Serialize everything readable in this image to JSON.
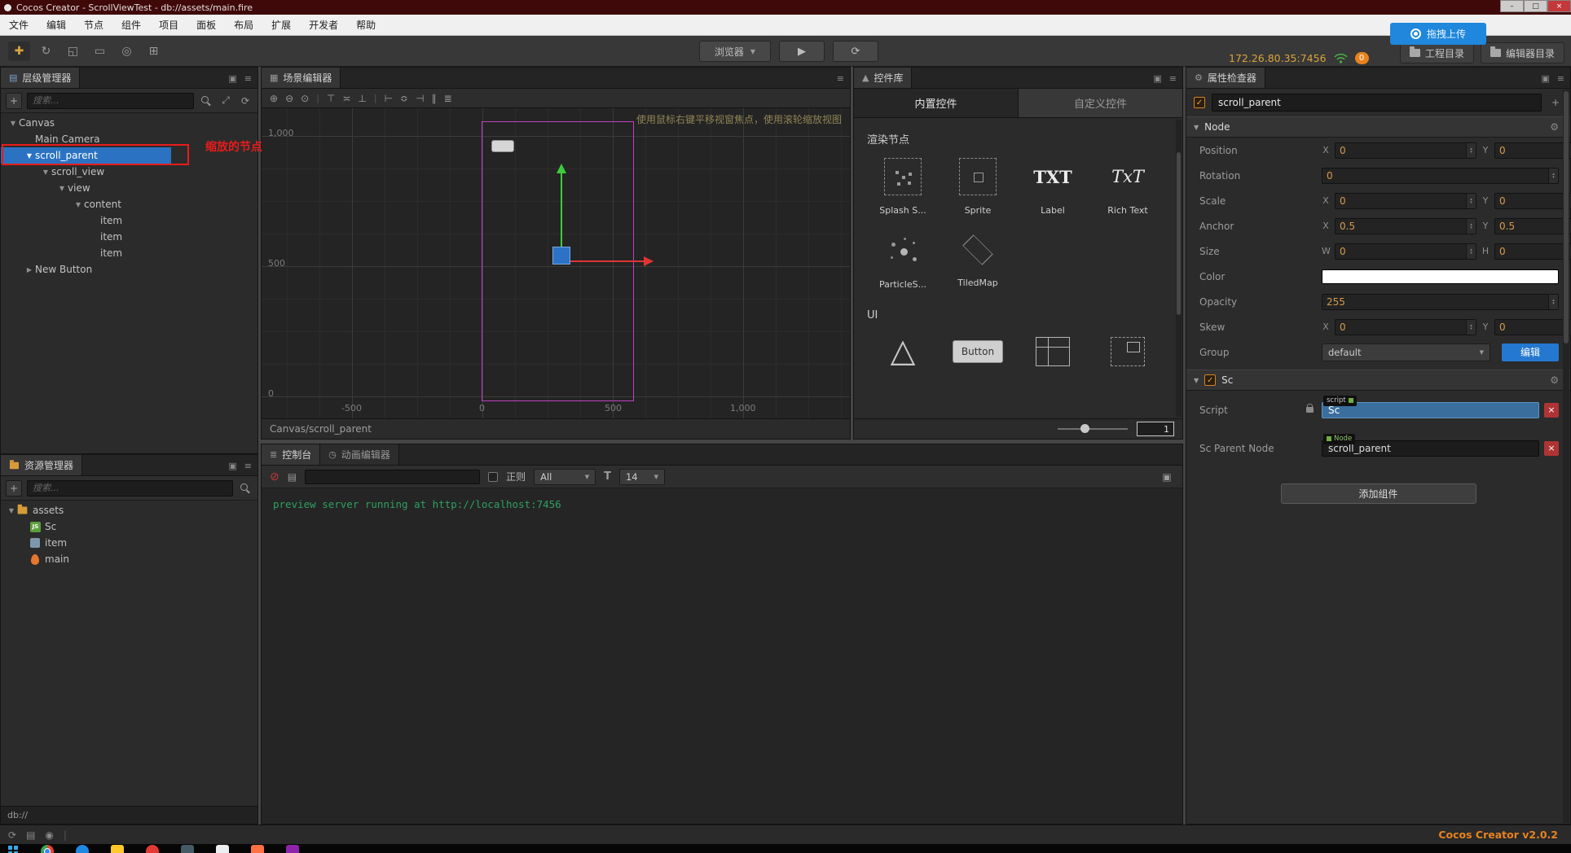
{
  "window": {
    "title": "Cocos Creator - ScrollViewTest - db://assets/main.fire"
  },
  "icons": {
    "minimize": "–",
    "maximize": "□",
    "close": "×",
    "hierarchy": "▤",
    "scene": "▦",
    "widgets": "▲",
    "inspector": "⚙",
    "console": "≣",
    "animation": "◷",
    "panel": "▣",
    "menu": "≡",
    "plus": "+",
    "caret": "▼",
    "play": "▶",
    "refresh": "⟳",
    "check": "✓",
    "expand": "⤢",
    "gear": "⚙",
    "clear": "⊘",
    "file": "▤",
    "font": "T",
    "popout": "▣",
    "eye": "◉",
    "list": "▤",
    "reload": "⟳"
  },
  "menubar": {
    "items": [
      "文件",
      "编辑",
      "节点",
      "组件",
      "项目",
      "面板",
      "布局",
      "扩展",
      "开发者",
      "帮助"
    ]
  },
  "toolbar": {
    "tools": [
      {
        "name": "move-tool-icon",
        "g": "✚"
      },
      {
        "name": "rotate-tool-icon",
        "g": "↻"
      },
      {
        "name": "scale-tool-icon",
        "g": "◱"
      },
      {
        "name": "rect-tool-icon",
        "g": "▭"
      },
      {
        "name": "pivot-tool-icon",
        "g": "◎"
      },
      {
        "name": "grid-tool-icon",
        "g": "⊞"
      }
    ],
    "browser_label": "浏览器",
    "address": "172.26.80.35:7456",
    "notification_count": "0",
    "upload_label": "拖拽上传",
    "project_dir_label": "工程目录",
    "editor_dir_label": "编辑器目录"
  },
  "hierarchy": {
    "tab": "层级管理器",
    "search_placeholder": "搜索...",
    "annotation": {
      "text": "缩放的节点",
      "color": "#e81c1c"
    },
    "nodes": [
      {
        "label": "Canvas",
        "depth": 0,
        "arrow": "▼",
        "selected": false
      },
      {
        "label": "Main Camera",
        "depth": 1,
        "arrow": "",
        "selected": false
      },
      {
        "label": "scroll_parent",
        "depth": 1,
        "arrow": "▼",
        "selected": true
      },
      {
        "label": "scroll_view",
        "depth": 2,
        "arrow": "▼",
        "selected": false
      },
      {
        "label": "view",
        "depth": 3,
        "arrow": "▼",
        "selected": false
      },
      {
        "label": "content",
        "depth": 4,
        "arrow": "▼",
        "selected": false
      },
      {
        "label": "item",
        "depth": 5,
        "arrow": "",
        "selected": false
      },
      {
        "label": "item",
        "depth": 5,
        "arrow": "",
        "selected": false
      },
      {
        "label": "item",
        "depth": 5,
        "arrow": "",
        "selected": false
      },
      {
        "label": "New Button",
        "depth": 1,
        "arrow": "▶",
        "selected": false
      }
    ]
  },
  "assets": {
    "tab": "资源管理器",
    "search_placeholder": "搜索...",
    "items": [
      {
        "label": "assets",
        "arrow": "▼",
        "type": "folder"
      },
      {
        "label": "Sc",
        "badge": "JS",
        "type": "javascript"
      },
      {
        "label": "item",
        "type": "prefab"
      },
      {
        "label": "main",
        "type": "scene-fire"
      }
    ],
    "status": "db://"
  },
  "scene": {
    "tab": "场景编辑器",
    "toolbar_icons": [
      {
        "name": "zoom-in-icon",
        "g": "⊕"
      },
      {
        "name": "zoom-out-icon",
        "g": "⊖"
      },
      {
        "name": "zoom-reset-icon",
        "g": "⊙"
      },
      {
        "name": "separator",
        "g": "|"
      },
      {
        "name": "align-top-icon",
        "g": "⊤"
      },
      {
        "name": "align-vcenter-icon",
        "g": "≍"
      },
      {
        "name": "align-bottom-icon",
        "g": "⊥"
      },
      {
        "name": "separator",
        "g": "|"
      },
      {
        "name": "align-left-icon",
        "g": "⊢"
      },
      {
        "name": "align-hcenter-icon",
        "g": "≎"
      },
      {
        "name": "align-right-icon",
        "g": "⊣"
      },
      {
        "name": "distribute-h-icon",
        "g": "∥"
      },
      {
        "name": "distribute-v-icon",
        "g": "≣"
      }
    ],
    "hint": "使用鼠标右键平移视窗焦点，使用滚轮缩放视图",
    "ruler": {
      "y_labels": [
        "1,000",
        "500",
        "0"
      ],
      "x_labels": [
        "-500",
        "0",
        "500",
        "1,000"
      ]
    },
    "breadcrumb": "Canvas/scroll_parent"
  },
  "widgets": {
    "tab": "控件库",
    "tabs": [
      {
        "label": "内置控件",
        "active": true
      },
      {
        "label": "自定义控件",
        "active": false
      }
    ],
    "render_section": "渲染节点",
    "render_items": [
      {
        "label": "Splash S...",
        "icon": "splash-sprite-icon"
      },
      {
        "label": "Sprite",
        "icon": "sprite-icon"
      },
      {
        "label": "Label",
        "icon": "label-icon",
        "icon_text": "TXT"
      },
      {
        "label": "Rich Text",
        "icon": "richtext-icon",
        "icon_text": "TxT"
      },
      {
        "label": "ParticleS...",
        "icon": "particle-icon"
      },
      {
        "label": "TiledMap",
        "icon": "tiledmap-icon"
      }
    ],
    "ui_section": "UI",
    "ui_items": [
      {
        "label": "",
        "icon": "mask-icon",
        "icon_text": "△"
      },
      {
        "label": "",
        "icon": "button-icon",
        "icon_text": "Button"
      },
      {
        "label": "",
        "icon": "layout-icon"
      },
      {
        "label": "",
        "icon": "widget-icon"
      }
    ],
    "zoom_value": "1"
  },
  "console": {
    "tabs": [
      {
        "label": "控制台",
        "active": true
      },
      {
        "label": "动画编辑器",
        "active": false
      }
    ],
    "regex_label": "正则",
    "level_value": "All",
    "fontsize_value": "14",
    "log_lines": [
      {
        "text": "preview server running at http://localhost:7456",
        "color": "#2fa05f"
      }
    ]
  },
  "inspector": {
    "tab": "属性检查器",
    "node_active": true,
    "node_name": "scroll_parent",
    "node_section": {
      "title": "Node",
      "rows": [
        {
          "label": "Position",
          "fields": [
            {
              "k": "X",
              "v": "0"
            },
            {
              "k": "Y",
              "v": "0"
            }
          ]
        },
        {
          "label": "Rotation",
          "fields": [
            {
              "k": "",
              "v": "0"
            }
          ]
        },
        {
          "label": "Scale",
          "fields": [
            {
              "k": "X",
              "v": "0"
            },
            {
              "k": "Y",
              "v": "0"
            }
          ]
        },
        {
          "label": "Anchor",
          "fields": [
            {
              "k": "X",
              "v": "0.5"
            },
            {
              "k": "Y",
              "v": "0.5"
            }
          ]
        },
        {
          "label": "Size",
          "fields": [
            {
              "k": "W",
              "v": "0"
            },
            {
              "k": "H",
              "v": "0"
            }
          ]
        },
        {
          "label": "Color",
          "color": "#ffffff"
        },
        {
          "label": "Opacity",
          "fields": [
            {
              "k": "",
              "v": "255"
            }
          ]
        },
        {
          "label": "Skew",
          "fields": [
            {
              "k": "X",
              "v": "0"
            },
            {
              "k": "Y",
              "v": "0"
            }
          ]
        },
        {
          "label": "Group",
          "dropdown": "default",
          "button": "编辑"
        }
      ]
    },
    "script_section": {
      "title": "Sc",
      "rows": [
        {
          "label": "Script",
          "badge": "script",
          "value": "Sc",
          "locked": true,
          "highlight": true
        },
        {
          "label": "Sc Parent Node",
          "badge": "Node",
          "value": "scroll_parent",
          "locked": false,
          "highlight": false
        }
      ],
      "add_component_label": "添加组件"
    }
  },
  "statusbar": {
    "version": "Cocos Creator v2.0.2"
  },
  "colors": {
    "selection_blue": "#2b73c2",
    "annotation_red": "#e81c1c",
    "accent_blue": "#2478cf",
    "value_orange": "#d89b4a",
    "log_green": "#2fa05f",
    "version_orange": "#e8821e",
    "design_rect_magenta": "#c23fc2"
  }
}
